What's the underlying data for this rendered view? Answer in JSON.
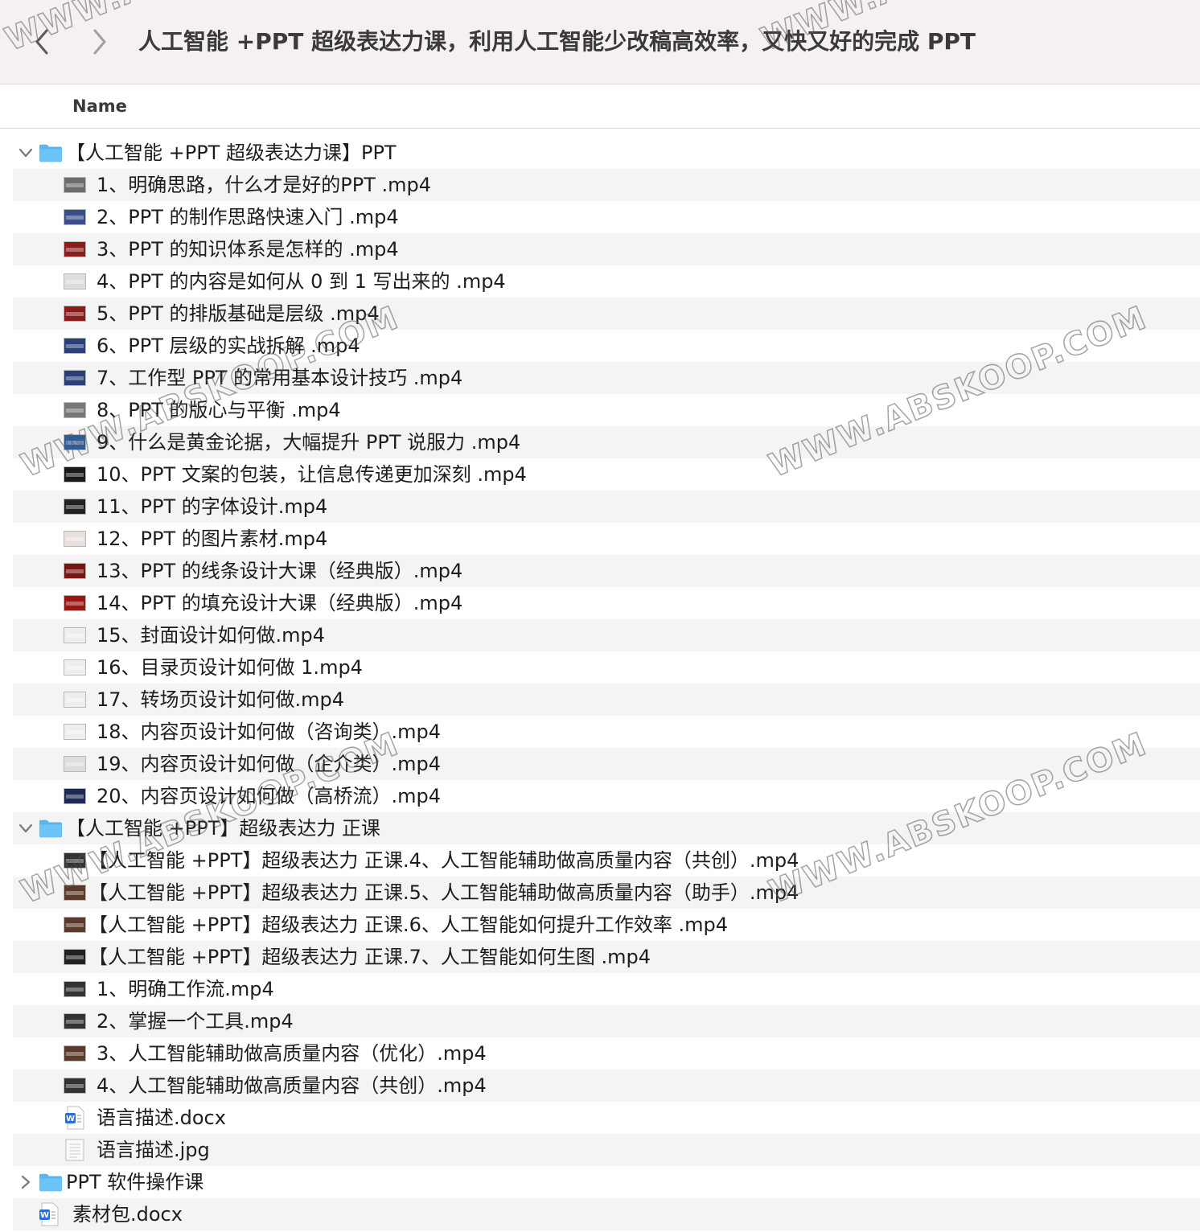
{
  "window": {
    "title": "人工智能 +PPT 超级表达力课，利用人工智能少改稿高效率，又快又好的完成 PPT"
  },
  "toolbar": {
    "back_icon": "chevron-left-icon",
    "forward_icon": "chevron-right-icon"
  },
  "header": {
    "name": "Name"
  },
  "colors": {
    "folder": "#5ab5ef",
    "alt_row": "#f4f4f4",
    "toolbar_bg": "#f6f1f1"
  },
  "rows": [
    {
      "type": "folder",
      "level": 0,
      "expanded": true,
      "name": "【人工智能 +PPT 超级表达力课】PPT"
    },
    {
      "type": "video",
      "level": 1,
      "thumb": "#6c6c6c",
      "name": "1、明确思路，什么才是好的PPT .mp4"
    },
    {
      "type": "video",
      "level": 1,
      "thumb": "#3a4d8a",
      "name": "2、PPT 的制作思路快速入门 .mp4"
    },
    {
      "type": "video",
      "level": 1,
      "thumb": "#8b1c1c",
      "name": "3、PPT 的知识体系是怎样的 .mp4"
    },
    {
      "type": "video",
      "level": 1,
      "thumb": "#dddddd",
      "name": "4、PPT 的内容是如何从 0 到 1 写出来的 .mp4"
    },
    {
      "type": "video",
      "level": 1,
      "thumb": "#8b1c1c",
      "name": "5、PPT 的排版基础是层级 .mp4"
    },
    {
      "type": "video",
      "level": 1,
      "thumb": "#2b3f7a",
      "name": "6、PPT 层级的实战拆解 .mp4"
    },
    {
      "type": "video",
      "level": 1,
      "thumb": "#2b3f7a",
      "name": "7、工作型 PPT 的常用基本设计技巧 .mp4"
    },
    {
      "type": "video",
      "level": 1,
      "thumb": "#777777",
      "name": "8、PPT 的版心与平衡 .mp4"
    },
    {
      "type": "video",
      "level": 1,
      "thumb": "#2b5d9e",
      "name": "9、什么是黄金论据，大幅提升 PPT 说服力 .mp4"
    },
    {
      "type": "video",
      "level": 1,
      "thumb": "#1a1a1a",
      "name": "10、PPT 文案的包装，让信息传递更加深刻 .mp4"
    },
    {
      "type": "video",
      "level": 1,
      "thumb": "#222222",
      "name": "11、PPT 的字体设计.mp4"
    },
    {
      "type": "video",
      "level": 1,
      "thumb": "#e8e0dc",
      "name": "12、PPT 的图片素材.mp4"
    },
    {
      "type": "video",
      "level": 1,
      "thumb": "#7a1515",
      "name": "13、PPT 的线条设计大课（经典版）.mp4"
    },
    {
      "type": "video",
      "level": 1,
      "thumb": "#9c1515",
      "name": "14、PPT 的填充设计大课（经典版）.mp4"
    },
    {
      "type": "video",
      "level": 1,
      "thumb": "#eeeeee",
      "name": "15、封面设计如何做.mp4"
    },
    {
      "type": "video",
      "level": 1,
      "thumb": "#eeeeee",
      "name": "16、目录页设计如何做 1.mp4"
    },
    {
      "type": "video",
      "level": 1,
      "thumb": "#eeeeee",
      "name": "17、转场页设计如何做.mp4"
    },
    {
      "type": "video",
      "level": 1,
      "thumb": "#eeeeee",
      "name": "18、内容页设计如何做（咨询类）.mp4"
    },
    {
      "type": "video",
      "level": 1,
      "thumb": "#dddddd",
      "name": "19、内容页设计如何做（企介类）.mp4"
    },
    {
      "type": "video",
      "level": 1,
      "thumb": "#1e2a55",
      "name": "20、内容页设计如何做（高桥流）.mp4"
    },
    {
      "type": "folder",
      "level": 0,
      "expanded": true,
      "name": "【人工智能 +PPT】超级表达力 正课"
    },
    {
      "type": "video",
      "level": 1,
      "thumb": "#333333",
      "name": "【人工智能 +PPT】超级表达力 正课.4、人工智能辅助做高质量内容（共创）.mp4"
    },
    {
      "type": "video",
      "level": 1,
      "thumb": "#5a3a2a",
      "name": "【人工智能 +PPT】超级表达力 正课.5、人工智能辅助做高质量内容（助手）.mp4"
    },
    {
      "type": "video",
      "level": 1,
      "thumb": "#5a3a2a",
      "name": "【人工智能 +PPT】超级表达力 正课.6、人工智能如何提升工作效率 .mp4"
    },
    {
      "type": "video",
      "level": 1,
      "thumb": "#222222",
      "name": "【人工智能 +PPT】超级表达力 正课.7、人工智能如何生图 .mp4"
    },
    {
      "type": "video",
      "level": 1,
      "thumb": "#333333",
      "name": "1、明确工作流.mp4"
    },
    {
      "type": "video",
      "level": 1,
      "thumb": "#333333",
      "name": "2、掌握一个工具.mp4"
    },
    {
      "type": "video",
      "level": 1,
      "thumb": "#5a3a2a",
      "name": "3、人工智能辅助做高质量内容（优化）.mp4"
    },
    {
      "type": "video",
      "level": 1,
      "thumb": "#333333",
      "name": "4、人工智能辅助做高质量内容（共创）.mp4"
    },
    {
      "type": "docx",
      "level": 1,
      "name": "语言描述.docx"
    },
    {
      "type": "jpg",
      "level": 1,
      "name": "语言描述.jpg"
    },
    {
      "type": "folder",
      "level": 0,
      "expanded": false,
      "name": "PPT 软件操作课"
    },
    {
      "type": "docx",
      "level": 0,
      "name": "素材包.docx"
    }
  ],
  "watermark": "WWW.ABSKOOP.COM"
}
